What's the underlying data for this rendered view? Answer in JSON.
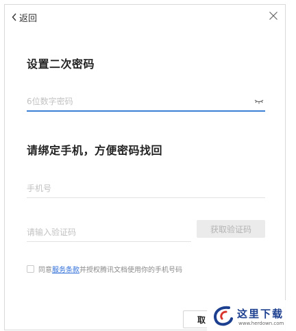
{
  "header": {
    "back_label": "返回",
    "back_icon": "chevron-left-icon",
    "close_icon": "close-icon"
  },
  "password_section": {
    "title": "设置二次密码",
    "placeholder": "6位数字密码",
    "value": "",
    "toggle_icon": "eye-closed-icon",
    "accent_color": "#3a7fd6"
  },
  "phone_section": {
    "title": "请绑定手机，方便密码找回",
    "phone_placeholder": "手机号",
    "code_placeholder": "请输入验证码",
    "get_code_label": "获取验证码"
  },
  "agreement": {
    "checked": false,
    "prefix": "同意",
    "link": "服务条款",
    "suffix": "并授权腾讯文档使用你的手机号码"
  },
  "footer": {
    "cancel_label": "取"
  },
  "watermark": {
    "text": "这里下载",
    "url": "www.herdown.com"
  }
}
